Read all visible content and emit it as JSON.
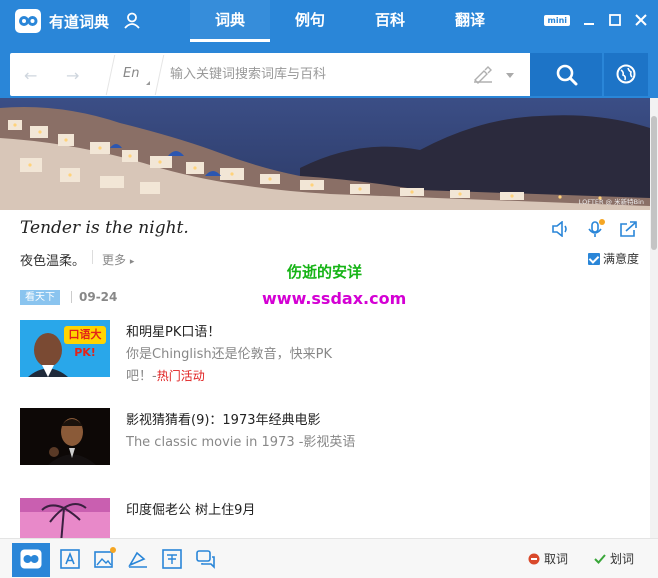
{
  "app": {
    "title": "有道词典"
  },
  "tabs": [
    {
      "label": "词典",
      "active": true
    },
    {
      "label": "例句",
      "active": false
    },
    {
      "label": "百科",
      "active": false
    },
    {
      "label": "翻译",
      "active": false
    }
  ],
  "window_controls": {
    "mini_label": "mini"
  },
  "search": {
    "lang_label": "En",
    "placeholder": "输入关键词搜索词库与百科",
    "value": ""
  },
  "banner": {
    "credit": "LOFTER @ 米新特Bin"
  },
  "daily": {
    "quote": "Tender is the night.",
    "translation": "夜色温柔。",
    "more_label": "更多",
    "satisfaction_label": "满意度",
    "satisfaction_checked": true
  },
  "overlays": {
    "line1": "伤逝的安详",
    "line2": "www.ssdax.com"
  },
  "feed": {
    "badge": "看天下",
    "date": "09-24",
    "articles": [
      {
        "thumb_label": "口语大PK!",
        "title": "和明星PK口语！",
        "desc_line1": "你是Chinglish还是伦敦音，快来PK",
        "desc_line2": "吧！-",
        "tag": "热门活动"
      },
      {
        "title": "影视猜猜看(9)：1973年经典电影",
        "desc_line1": "The classic movie in 1973 -影视英语"
      },
      {
        "title": "印度倔老公 树上住9月"
      }
    ]
  },
  "bottom": {
    "cancel_label": "取词",
    "select_label": "划词"
  },
  "colors": {
    "brand_blue": "#2a86d8",
    "overlay_green": "#16b416",
    "overlay_magenta": "#d400d4",
    "tag_red": "#e02020"
  }
}
